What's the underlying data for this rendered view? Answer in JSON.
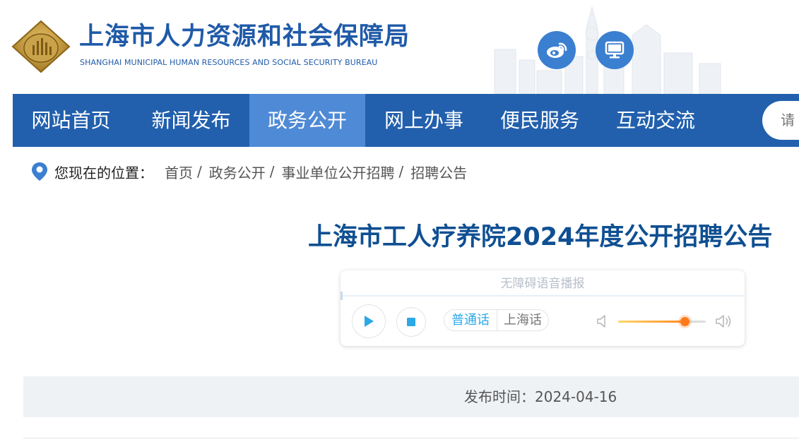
{
  "header": {
    "title": "上海市人力资源和社会保障局",
    "subtitle": "SHANGHAI MUNICIPAL HUMAN RESOURCES AND SOCIAL SECURITY BUREAU",
    "brand_color": "#1f5aa8"
  },
  "nav": {
    "items": [
      {
        "label": "网站首页",
        "active": false
      },
      {
        "label": "新闻发布",
        "active": false
      },
      {
        "label": "政务公开",
        "active": true
      },
      {
        "label": "网上办事",
        "active": false
      },
      {
        "label": "便民服务",
        "active": false
      },
      {
        "label": "互动交流",
        "active": false
      }
    ],
    "search_placeholder": "请",
    "bg_color": "#2260ad",
    "active_color": "#4e8ad5"
  },
  "breadcrumb": {
    "label": "您现在的位置：",
    "items": [
      "首页",
      "政务公开",
      "事业单位公开招聘",
      "招聘公告"
    ],
    "separator": "/"
  },
  "article": {
    "title": "上海市工人疗养院2024年度公开招聘公告",
    "publish_label": "发布时间：",
    "publish_date": "2024-04-16"
  },
  "player": {
    "header": "无障碍语音播报",
    "languages": [
      "普通话",
      "上海话"
    ],
    "selected_language": "普通话",
    "volume": 0.76
  }
}
